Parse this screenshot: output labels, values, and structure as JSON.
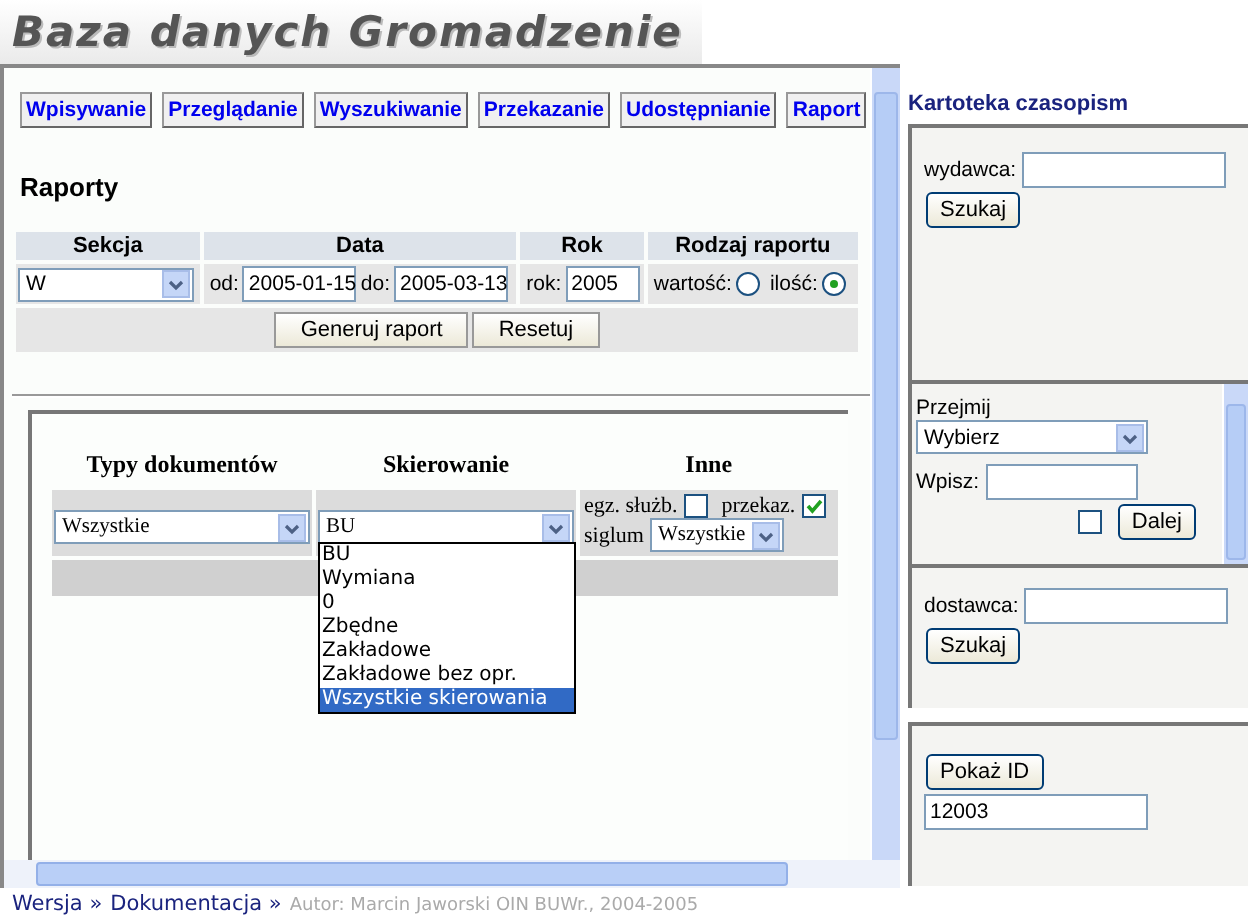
{
  "header": {
    "title": "Baza danych Gromadzenie"
  },
  "tabs": [
    {
      "label": "Wpisywanie"
    },
    {
      "label": "Przeglądanie"
    },
    {
      "label": "Wyszukiwanie"
    },
    {
      "label": "Przekazanie"
    },
    {
      "label": "Udostępnianie"
    },
    {
      "label": "Raport"
    }
  ],
  "report": {
    "heading": "Raporty",
    "columns": [
      "Sekcja",
      "Data",
      "Rok",
      "Rodzaj raportu"
    ],
    "section": "W",
    "from_label": "od:",
    "from": "2005-01-15",
    "to_label": "do:",
    "to": "2005-03-13",
    "year_label": "rok:",
    "year": "2005",
    "options": [
      {
        "label": "wartość:",
        "selected": false
      },
      {
        "label": "ilość:",
        "selected": true
      }
    ],
    "buttons": [
      "Generuj raport",
      "Resetuj"
    ]
  },
  "filters": {
    "columns": [
      "Typy dokumentów",
      "Skierowanie",
      "Inne"
    ],
    "doc_type": "Wszystkie",
    "direction": "BU",
    "direction_options": [
      {
        "label": "BU",
        "selected": false
      },
      {
        "label": "Wymiana",
        "selected": false
      },
      {
        "label": "0",
        "selected": false
      },
      {
        "label": "Zbędne",
        "selected": false
      },
      {
        "label": "Zakładowe",
        "selected": false
      },
      {
        "label": "Zakładowe bez opr.",
        "selected": false
      },
      {
        "label": "Wszystkie skierowania",
        "selected": true
      }
    ],
    "checks": [
      {
        "label": "egz. służb.",
        "checked": false
      },
      {
        "label": "przekaz.",
        "checked": true
      }
    ],
    "siglum_label": "siglum",
    "siglum": "Wszystkie"
  },
  "sidebar": {
    "title": "Kartoteka czasopism",
    "panels": [
      {
        "kind": "search",
        "label": "wydawca:",
        "button": "Szukaj"
      },
      {
        "kind": "transfer",
        "label": "Przejmij",
        "select": "Wybierz",
        "input_label": "Wpisz:",
        "checked": false,
        "button": "Dalej"
      },
      {
        "kind": "search",
        "label": "dostawca:",
        "button": "Szukaj"
      },
      {
        "kind": "id",
        "button": "Pokaż ID",
        "value": "12003"
      }
    ]
  },
  "footer": {
    "links": [
      "Wersja »",
      "Dokumentacja »"
    ],
    "credit": "Autor: Marcin Jaworski OIN BUWr., 2004-2005"
  }
}
